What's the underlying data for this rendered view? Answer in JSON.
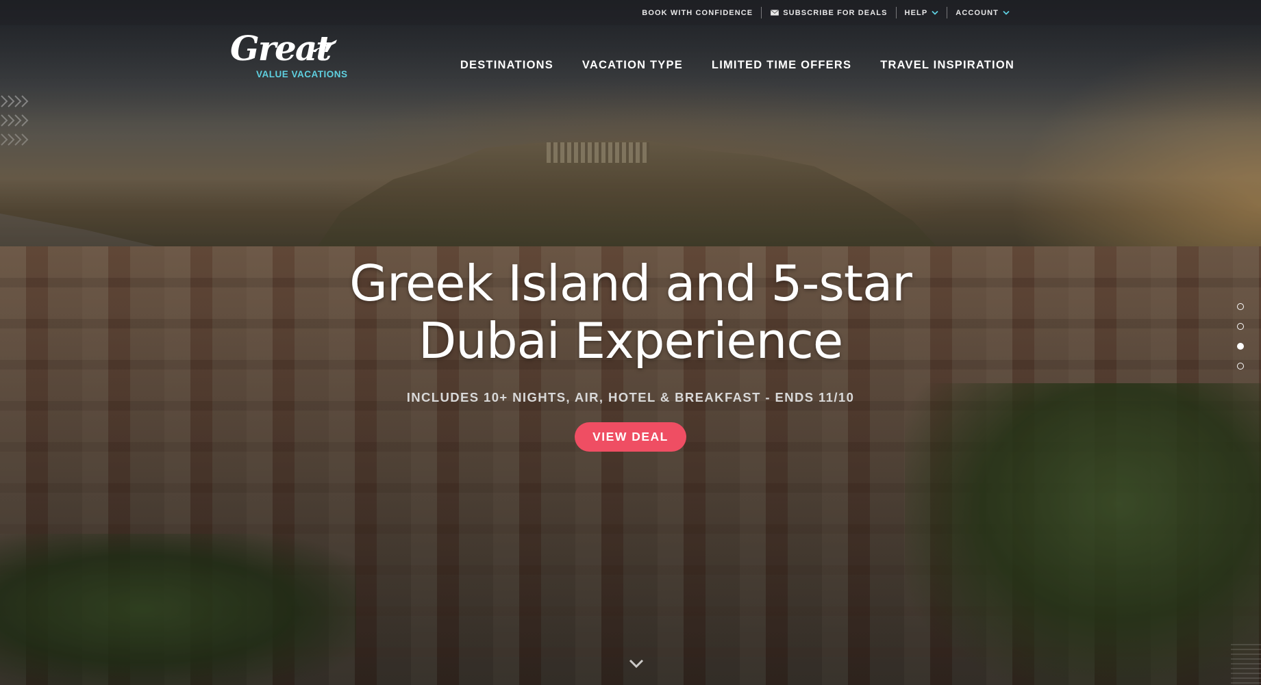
{
  "utility_bar": {
    "items": [
      {
        "label": "BOOK WITH CONFIDENCE",
        "icon": null,
        "dropdown": false
      },
      {
        "label": "SUBSCRIBE FOR DEALS",
        "icon": "mail-icon",
        "dropdown": false
      },
      {
        "label": "HELP",
        "icon": null,
        "dropdown": true
      },
      {
        "label": "ACCOUNT",
        "icon": null,
        "dropdown": true
      }
    ]
  },
  "logo": {
    "script_text": "Great",
    "sub_text": "VALUE VACATIONS",
    "accent_color": "#5fd0e0"
  },
  "main_nav": {
    "items": [
      {
        "label": "DESTINATIONS"
      },
      {
        "label": "VACATION TYPE"
      },
      {
        "label": "LIMITED TIME OFFERS"
      },
      {
        "label": "TRAVEL INSPIRATION"
      }
    ]
  },
  "hero": {
    "title": "Greek Island and 5-star Dubai Experience",
    "subtitle": "INCLUDES 10+ NIGHTS, AIR, HOTEL & BREAKFAST - ENDS 11/10",
    "cta_label": "VIEW DEAL",
    "cta_color": "#ef4e63"
  },
  "slider": {
    "total_slides": 4,
    "active_index": 2
  },
  "icons": {
    "scroll": "chevron-down-icon",
    "dropdown": "chevron-down-icon",
    "logo_plane": "plane-icon"
  }
}
